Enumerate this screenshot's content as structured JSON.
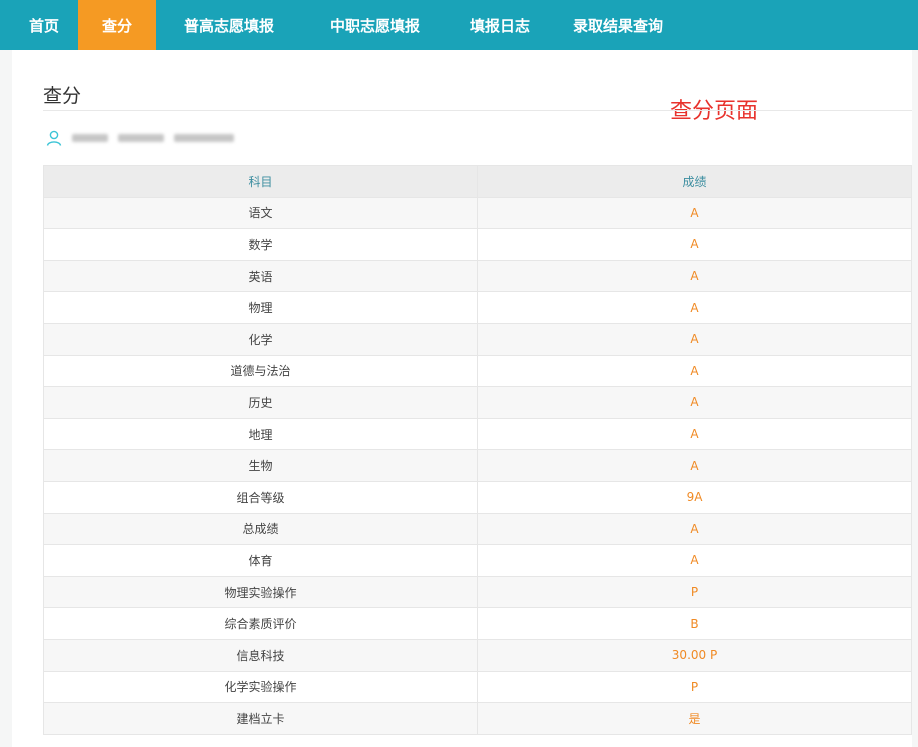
{
  "nav": {
    "items": [
      {
        "label": "首页",
        "active": false
      },
      {
        "label": "查分",
        "active": true
      },
      {
        "label": "普高志愿填报",
        "active": false
      },
      {
        "label": "中职志愿填报",
        "active": false
      },
      {
        "label": "填报日志",
        "active": false
      },
      {
        "label": "录取结果查询",
        "active": false
      }
    ]
  },
  "page": {
    "title": "查分",
    "annotation": "查分页面"
  },
  "colors": {
    "nav_bg": "#1aa3b8",
    "nav_active": "#f59a23",
    "score_text": "#f08a24",
    "header_text": "#3d8ea0",
    "annotation": "#e8322c"
  },
  "table": {
    "headers": {
      "subject": "科目",
      "score": "成绩"
    },
    "rows": [
      {
        "subject": "语文",
        "score": "A"
      },
      {
        "subject": "数学",
        "score": "A"
      },
      {
        "subject": "英语",
        "score": "A"
      },
      {
        "subject": "物理",
        "score": "A"
      },
      {
        "subject": "化学",
        "score": "A"
      },
      {
        "subject": "道德与法治",
        "score": "A"
      },
      {
        "subject": "历史",
        "score": "A"
      },
      {
        "subject": "地理",
        "score": "A"
      },
      {
        "subject": "生物",
        "score": "A"
      },
      {
        "subject": "组合等级",
        "score": "9A"
      },
      {
        "subject": "总成绩",
        "score": "A"
      },
      {
        "subject": "体育",
        "score": "A"
      },
      {
        "subject": "物理实验操作",
        "score": "P"
      },
      {
        "subject": "综合素质评价",
        "score": "B"
      },
      {
        "subject": "信息科技",
        "score": "30.00 P"
      },
      {
        "subject": "化学实验操作",
        "score": "P"
      },
      {
        "subject": "建档立卡",
        "score": "是"
      }
    ]
  }
}
